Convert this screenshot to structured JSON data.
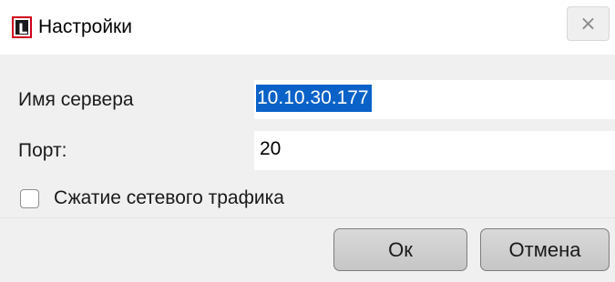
{
  "window": {
    "title": "Настройки",
    "icon": "app-logo-icon",
    "icon_letter": "L",
    "icon_border_color": "#d0021b",
    "close_glyph": "×"
  },
  "form": {
    "server_label": "Имя сервера",
    "server_value": "10.10.30.177",
    "server_value_selected": true,
    "selection_color": "#0a62c8",
    "port_label": "Порт:",
    "port_value": "20",
    "compression_label": "Сжатие сетевого трафика",
    "compression_checked": false
  },
  "buttons": {
    "ok_label": "Ок",
    "cancel_label": "Отмена"
  }
}
